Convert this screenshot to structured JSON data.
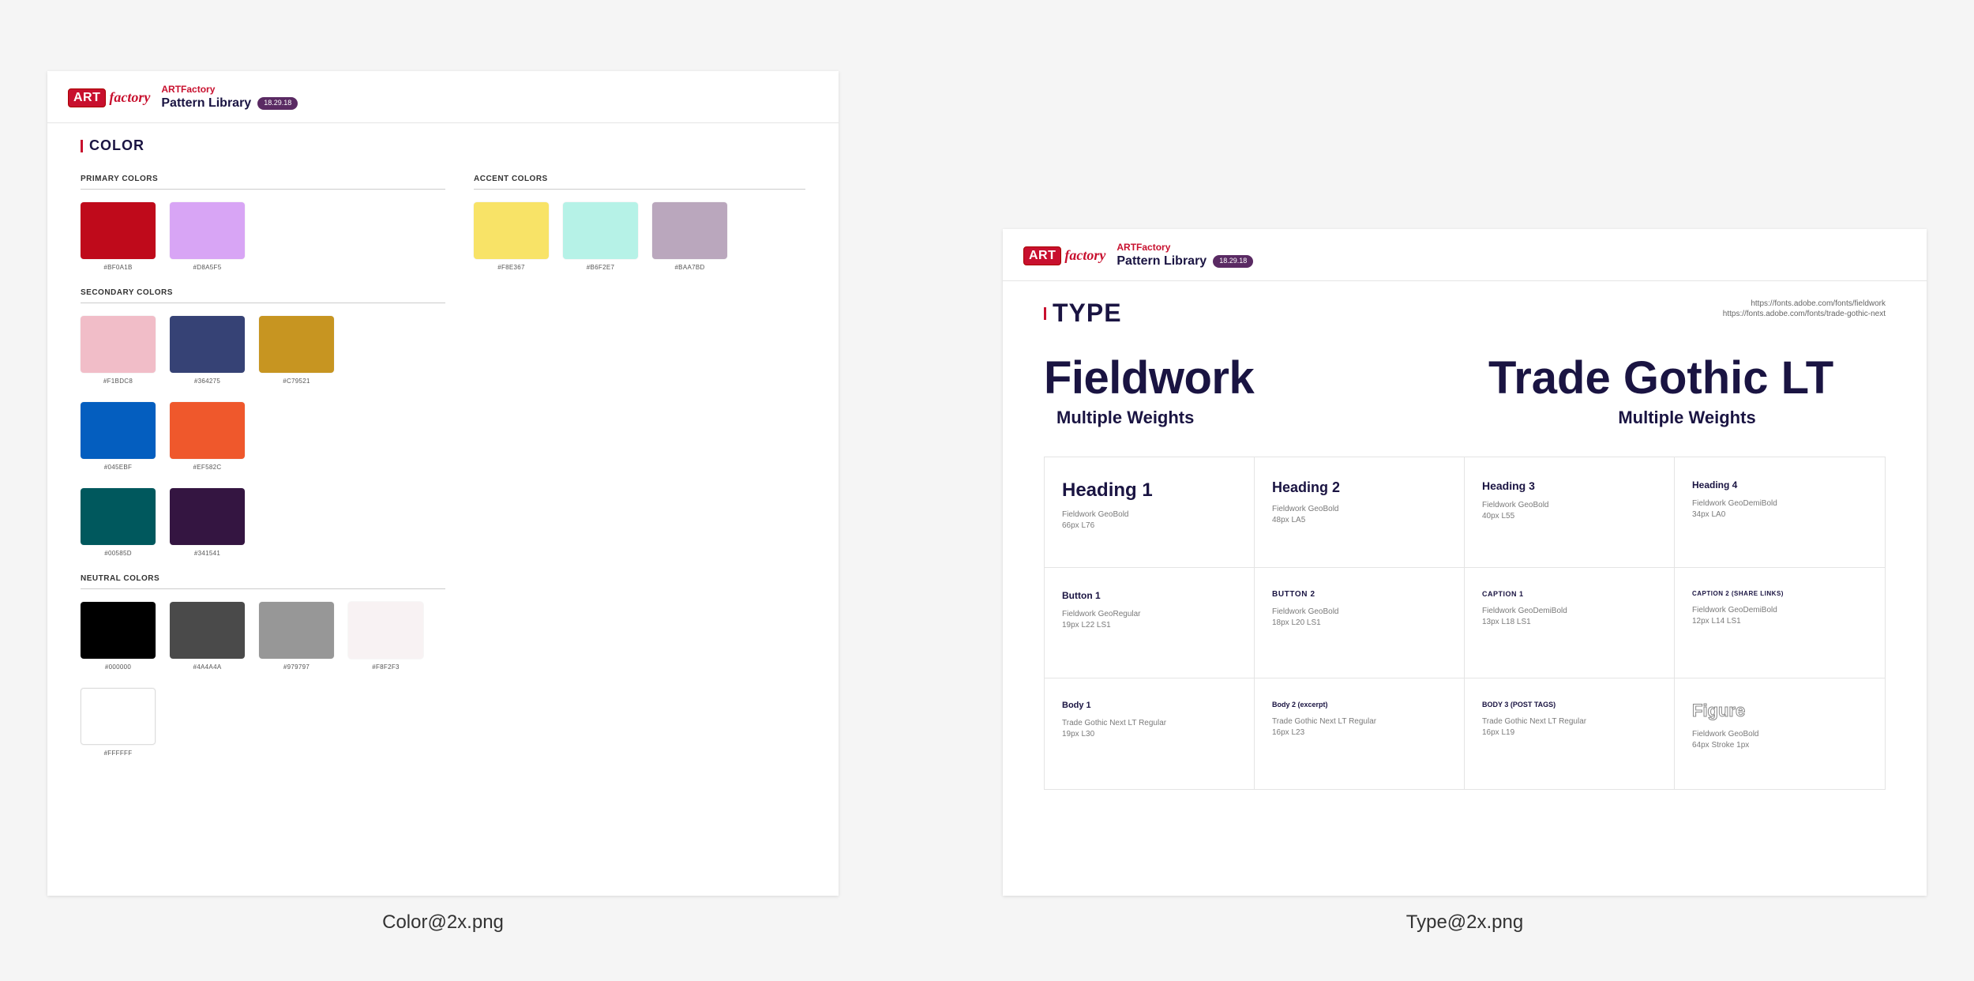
{
  "captions": {
    "color": "Color@2x.png",
    "type": "Type@2x.png"
  },
  "header": {
    "logo_badge": "ART",
    "logo_script": "factory",
    "sup": "ARTFactory",
    "title": "Pattern Library",
    "pill": "18.29.18"
  },
  "color": {
    "section": "COLOR",
    "groups": {
      "primary": {
        "label": "PRIMARY COLORS",
        "items": [
          {
            "hex": "#BF0A1B"
          },
          {
            "hex": "#D8A5F5"
          }
        ]
      },
      "accent": {
        "label": "ACCENT COLORS",
        "items": [
          {
            "hex": "#F8E367"
          },
          {
            "hex": "#B6F2E7"
          },
          {
            "hex": "#BAA7BD"
          }
        ]
      },
      "secondary": {
        "label": "SECONDARY COLORS",
        "items": [
          {
            "hex": "#F1BDC8"
          },
          {
            "hex": "#364275"
          },
          {
            "hex": "#C79521"
          },
          {
            "hex": "#045EBF"
          },
          {
            "hex": "#EF582C"
          },
          {
            "hex": "#00585D"
          },
          {
            "hex": "#341541"
          }
        ]
      },
      "neutral": {
        "label": "NEUTRAL COLORS",
        "items": [
          {
            "hex": "#000000"
          },
          {
            "hex": "#4A4A4A"
          },
          {
            "hex": "#979797"
          },
          {
            "hex": "#F8F2F3"
          },
          {
            "hex": "#FFFFFF",
            "outlined": true
          }
        ]
      }
    }
  },
  "type": {
    "section": "TYPE",
    "links": [
      "https://fonts.adobe.com/fonts/fieldwork",
      "https://fonts.adobe.com/fonts/trade-gothic-next"
    ],
    "fonts": [
      {
        "name": "Fieldwork",
        "sub": "Multiple Weights"
      },
      {
        "name": "Trade Gothic LT",
        "sub": "Multiple Weights"
      }
    ],
    "cells": [
      {
        "title": "Heading 1",
        "cls": "h1",
        "meta1": "Fieldwork GeoBold",
        "meta2": "66px L76"
      },
      {
        "title": "Heading 2",
        "cls": "h2",
        "meta1": "Fieldwork GeoBold",
        "meta2": "48px LA5"
      },
      {
        "title": "Heading 3",
        "cls": "h3",
        "meta1": "Fieldwork GeoBold",
        "meta2": "40px L55"
      },
      {
        "title": "Heading 4",
        "cls": "h4",
        "meta1": "Fieldwork GeoDemiBold",
        "meta2": "34px LA0"
      },
      {
        "title": "Button 1",
        "cls": "btn1",
        "meta1": "Fieldwork GeoRegular",
        "meta2": "19px L22 LS1"
      },
      {
        "title": "BUTTON 2",
        "cls": "btn2",
        "meta1": "Fieldwork GeoBold",
        "meta2": "18px L20 LS1"
      },
      {
        "title": "CAPTION 1",
        "cls": "cap1",
        "meta1": "Fieldwork GeoDemiBold",
        "meta2": "13px L18 LS1"
      },
      {
        "title": "CAPTION 2 (SHARE LINKS)",
        "cls": "cap2",
        "meta1": "Fieldwork GeoDemiBold",
        "meta2": "12px L14 LS1"
      },
      {
        "title": "Body 1",
        "cls": "body1",
        "meta1": "Trade Gothic Next LT Regular",
        "meta2": "19px L30"
      },
      {
        "title": "Body 2 (excerpt)",
        "cls": "body2",
        "meta1": "Trade Gothic Next LT Regular",
        "meta2": "16px L23"
      },
      {
        "title": "BODY 3 (POST TAGS)",
        "cls": "body3",
        "meta1": "Trade Gothic Next LT Regular",
        "meta2": "16px L19"
      },
      {
        "title": "Figure",
        "cls": "figure-title",
        "meta1": "Fieldwork GeoBold",
        "meta2": "64px Stroke 1px"
      }
    ]
  }
}
